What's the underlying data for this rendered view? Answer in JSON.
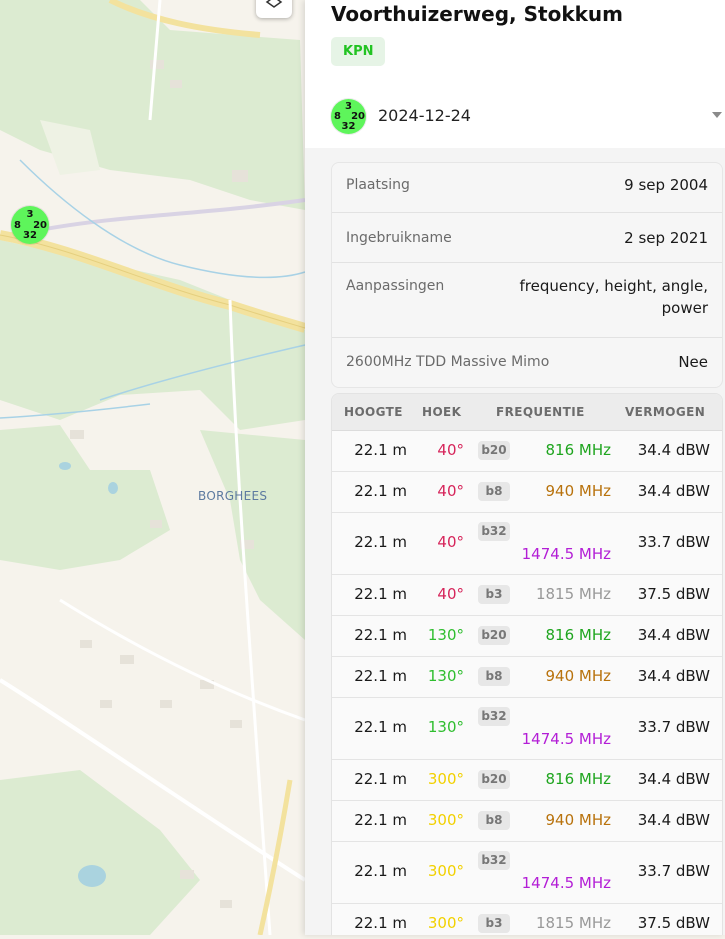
{
  "map": {
    "place_label": "BORGHEES",
    "cluster": {
      "top": "3",
      "left": "8",
      "right": "20",
      "bottom": "32"
    }
  },
  "panel": {
    "title": "Voorthuizerweg, Stokkum",
    "operator": "KPN",
    "operator_color": "#22c322",
    "date": "2024-12-24",
    "info": [
      {
        "label": "Plaatsing",
        "value": "9 sep 2004"
      },
      {
        "label": "Ingebruikname",
        "value": "2 sep 2021"
      },
      {
        "label": "Aanpassingen",
        "value": "frequency, height, angle, power"
      },
      {
        "label": "2600MHz TDD Massive Mimo",
        "value": "Nee"
      }
    ],
    "table": {
      "headers": [
        "HOOGTE",
        "HOEK",
        "FREQUENTIE",
        "VERMOGEN"
      ],
      "rows": [
        {
          "height": "22.1 m",
          "angle": "40°",
          "band": "b20",
          "freq": "816 MHz",
          "power": "34.4 dBW"
        },
        {
          "height": "22.1 m",
          "angle": "40°",
          "band": "b8",
          "freq": "940 MHz",
          "power": "34.4 dBW"
        },
        {
          "height": "22.1 m",
          "angle": "40°",
          "band": "b32",
          "freq": "1474.5 MHz",
          "power": "33.7 dBW"
        },
        {
          "height": "22.1 m",
          "angle": "40°",
          "band": "b3",
          "freq": "1815 MHz",
          "power": "37.5 dBW"
        },
        {
          "height": "22.1 m",
          "angle": "130°",
          "band": "b20",
          "freq": "816 MHz",
          "power": "34.4 dBW"
        },
        {
          "height": "22.1 m",
          "angle": "130°",
          "band": "b8",
          "freq": "940 MHz",
          "power": "34.4 dBW"
        },
        {
          "height": "22.1 m",
          "angle": "130°",
          "band": "b32",
          "freq": "1474.5 MHz",
          "power": "33.7 dBW"
        },
        {
          "height": "22.1 m",
          "angle": "300°",
          "band": "b20",
          "freq": "816 MHz",
          "power": "34.4 dBW"
        },
        {
          "height": "22.1 m",
          "angle": "300°",
          "band": "b8",
          "freq": "940 MHz",
          "power": "34.4 dBW"
        },
        {
          "height": "22.1 m",
          "angle": "300°",
          "band": "b32",
          "freq": "1474.5 MHz",
          "power": "33.7 dBW"
        },
        {
          "height": "22.1 m",
          "angle": "300°",
          "band": "b3",
          "freq": "1815 MHz",
          "power": "37.5 dBW"
        }
      ]
    },
    "colors": {
      "angle_40": "#d6245a",
      "angle_130": "#2fbe2f",
      "angle_300": "#f2d100",
      "freq_816": "#1fa51f",
      "freq_940": "#b8720c",
      "freq_1474": "#b31ed6",
      "freq_1815": "#999999"
    }
  }
}
